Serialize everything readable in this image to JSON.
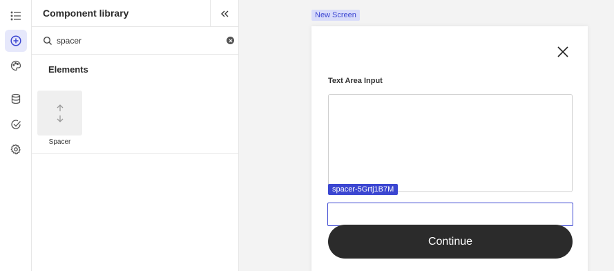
{
  "nav_rail": {
    "items": [
      {
        "icon": "list-icon"
      },
      {
        "icon": "add-circle-icon",
        "active": true
      },
      {
        "icon": "palette-icon"
      },
      {
        "icon": "database-icon"
      },
      {
        "icon": "check-circle-icon"
      },
      {
        "icon": "gear-icon"
      }
    ]
  },
  "panel": {
    "title": "Component library",
    "collapse_icon": "double-chevron-left-icon",
    "search": {
      "value": "spacer",
      "placeholder": "Search"
    },
    "section_title": "Elements",
    "elements": [
      {
        "label": "Spacer",
        "icon": "vertical-arrows-icon"
      }
    ]
  },
  "canvas": {
    "screen_tag": "New Screen",
    "close_icon": "close-icon",
    "field_label": "Text Area Input",
    "spacer_badge": "spacer-5Grtj1B7M",
    "continue_label": "Continue"
  },
  "colors": {
    "accent": "#3b46d1",
    "accent_light": "#d8dcfa",
    "button_dark": "#2b2b2b"
  }
}
